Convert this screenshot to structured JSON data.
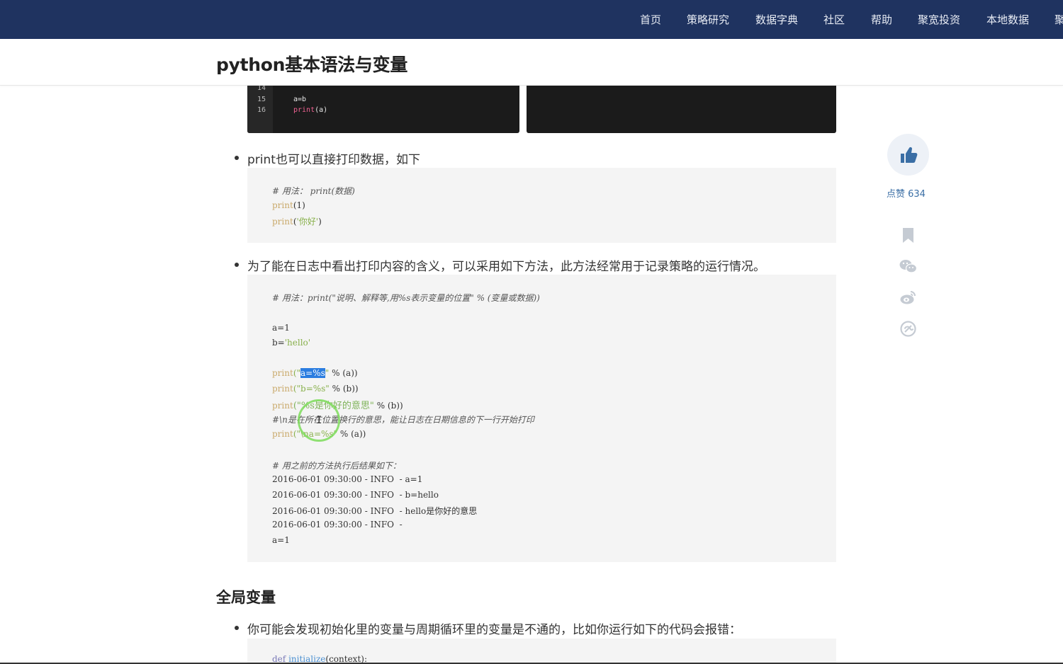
{
  "nav": {
    "items": [
      "首页",
      "策略研究",
      "数据字典",
      "社区",
      "帮助",
      "聚宽投资",
      "本地数据",
      "聚"
    ]
  },
  "page": {
    "title": "python基本语法与变量"
  },
  "dark_code": {
    "line_numbers": [
      "14",
      "15",
      "16"
    ],
    "line15": "a=b",
    "line16_fn": "print",
    "line16_arg": "(a)"
  },
  "section1": {
    "bullet": "print也可以直接打印数据，如下",
    "code": {
      "comment": "# 用法： print(数据)",
      "l2_fn": "print",
      "l2_rest": "(1)",
      "l3_fn": "print",
      "l3_open": "(",
      "l3_str": "'你好'",
      "l3_close": ")"
    }
  },
  "section2": {
    "bullet": "为了能在日志中看出打印内容的含义，可以采用如下方法，此方法经常用于记录策略的运行情况。",
    "code": {
      "comment1": "# 用法：print(\"说明、解释等,用%s表示变量的位置\" % (变量或数据))",
      "a_assign": "a=1",
      "b_assign_pre": "b=",
      "b_assign_str": "'hello'",
      "p1_fn": "print",
      "p1_open": "(\"",
      "p1_sel": "a=%s",
      "p1_close_str": "\"",
      "p1_rest": " % (a))",
      "p2_fn": "print",
      "p2_str": "(\"b=%s\"",
      "p2_rest": " % (b))",
      "p3_fn": "print",
      "p3_str": "(\"%s是你好的意思\"",
      "p3_rest": " % (b))",
      "comment2": "#\\n是在所在位置换行的意思，能让日志在日期信息的下一行开始打印",
      "p4_fn": "print",
      "p4_str": "(\"\\na=%s\"",
      "p4_rest": " % (a))",
      "comment3": "# 用之前的方法执行后结果如下：",
      "out1": "2016-06-01 09:30:00 - INFO  - a=1",
      "out2": "2016-06-01 09:30:00 - INFO  - b=hello",
      "out3": "2016-06-01 09:30:00 - INFO  - hello是你好的意思",
      "out4": "2016-06-01 09:30:00 - INFO  -",
      "out5": "a=1"
    }
  },
  "section3": {
    "heading": "全局变量",
    "bullet": "你可能会发现初始化里的变量与周期循环里的变量是不通的，比如你运行如下的代码会报错：",
    "code_kw": "def",
    "code_fn": "initialize",
    "code_rest": "(context):"
  },
  "sidebar": {
    "like_label": "点赞 634",
    "icons": [
      "thumbs-up-icon",
      "bookmark-icon",
      "wechat-icon",
      "weibo-icon",
      "share-icon"
    ]
  },
  "colors": {
    "nav_bg": "#1f3360",
    "code_bg": "#f4f4f4",
    "like_text": "#3a6ea5",
    "selection": "#2b7de0"
  }
}
